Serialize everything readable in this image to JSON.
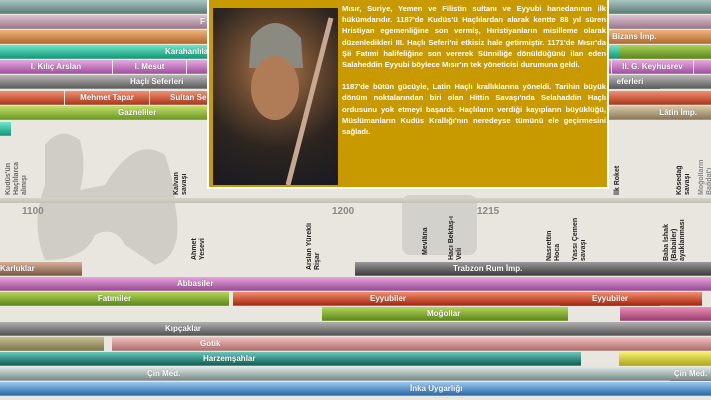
{
  "top_bars": [
    {
      "label": "",
      "color": "#6d8f8b"
    },
    {
      "label": "F",
      "color": "#b495a8"
    },
    {
      "label": "Bizans İmp.",
      "color": "#c9874a"
    },
    {
      "label": "Karahanlılar",
      "color": "#2fb394"
    },
    {
      "label": "Haçlı Seferleri",
      "color": "#7a7a7a"
    },
    {
      "label": "Gazneliler",
      "color": "#86a830"
    }
  ],
  "seljuk_segments": [
    "I. Kılıç Arslan",
    "I. Mesut",
    "",
    "II. G. Keyhusrev",
    ""
  ],
  "sultan_segments": [
    "",
    "Mehmet Tapar",
    "Sultan Sen"
  ],
  "right_labels": {
    "crusades": "eferleri",
    "latin": "Lâtin İmp."
  },
  "years": [
    "1100",
    "1200",
    "1215"
  ],
  "events": [
    "Kudüs'ün Haçlılarca alınışı",
    "Kalvan savaşı",
    "Ahmet Yesevi",
    "Arslan Yürekli Rişar",
    "Mevlâna",
    "Hacı Bektaş-ı Veli",
    "Nasrettin Hoca",
    "Yassı Çemen savaşı",
    "İlk Roket",
    "Kösedağ savaşı",
    "Baba İshak (Babailer) ayaklanması",
    "Moğolların Bağdat'ı işgali"
  ],
  "bottom_bars": {
    "karluklar": "Karluklar",
    "trabzon": "Trabzon Rum İmp.",
    "abbasiler": "Abbasiler",
    "fatimiler": "Fatımiler",
    "eyyubiler": "Eyyubiler",
    "mogollar": "Moğollar",
    "kipcaklar": "Kıpçaklar",
    "gotik": "Gotik",
    "harzem": "Harzemşahlar",
    "cin": "Çin Med.",
    "inka": "İnka Uygarlığı"
  },
  "popup": {
    "p1": "Mısır, Suriye, Yemen ve Filistin sultanı ve Eyyubi hanedanının ilk hükümdarıdır. 1187'de Kudüs'ü Haçlılardan alarak kentte 88 yıl süren Hristiyan egemenliğine son vermiş, Hıristiyanların misilleme olarak düzenledikleri III. Haçlı Seferi'ni etkisiz hale getirmiştir. 1171'de Mısır'da Şii Fatımi halifeliğine son vererek Sünniliğe dönüldüğünü ilan eden Salaheddin Eyyubi böylece Mısır'ın tek yöneticisi durumuna geldi.",
    "p2": "1187'de bütün gücüyle, Latin Haçlı krallıklarına yöneldi. Tarihin büyük dönüm noktalarından biri olan Hittin Savaşı'nda Selahaddin Haçlı ordusunu yok etmeyi başardı. Haçlıların verdiği kayıpların büyüklüğü, Müslümanların Kudüs Krallığı'nın neredeyse tümünü ele geçirmesini sağladı."
  }
}
